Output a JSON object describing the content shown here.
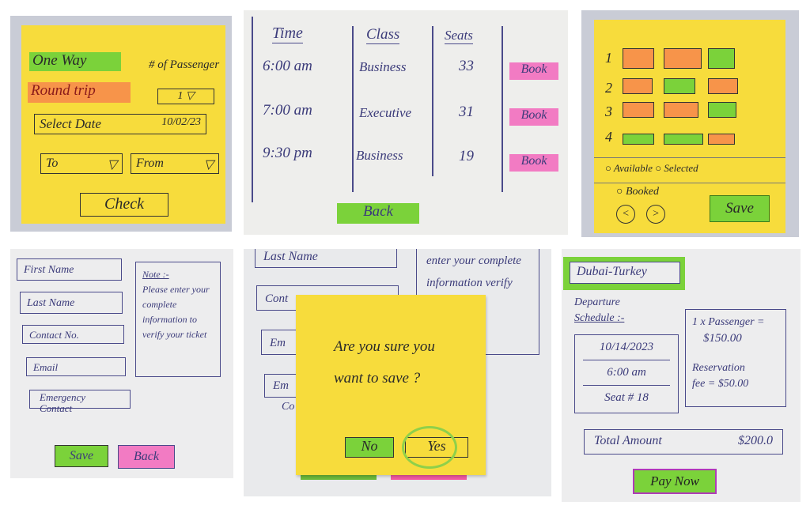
{
  "search_screen": {
    "one_way": "One Way",
    "round_trip": "Round trip",
    "passengers_label": "# of Passenger",
    "passengers_value": "1",
    "select_date_label": "Select Date",
    "select_date_value": "10/02/23",
    "to_label": "To",
    "from_label": "From",
    "check_button": "Check"
  },
  "flights_screen": {
    "headers": [
      "Time",
      "Class",
      "Seats"
    ],
    "rows": [
      {
        "time": "6:00 am",
        "class": "Business",
        "seats": "33",
        "action": "Book"
      },
      {
        "time": "7:00 am",
        "class": "Executive",
        "seats": "31",
        "action": "Book"
      },
      {
        "time": "9:30 pm",
        "class": "Business",
        "seats": "19",
        "action": "Book"
      }
    ],
    "back_button": "Back"
  },
  "seat_screen": {
    "row_labels": [
      "1",
      "2",
      "3",
      "4"
    ],
    "seat_status": [
      [
        "booked",
        "booked",
        "available"
      ],
      [
        "booked",
        "available",
        "booked"
      ],
      [
        "booked",
        "booked",
        "available"
      ],
      [
        "available",
        "available",
        "booked"
      ]
    ],
    "colors": {
      "available": "#7bd23a",
      "booked": "#f7944a"
    },
    "legend_available": "Available",
    "legend_selected": "Selected",
    "legend_booked": "Booked",
    "prev_icon": "chevron-left-icon",
    "next_icon": "chevron-right-icon",
    "save_button": "Save"
  },
  "passenger_form": {
    "first_name": "First Name",
    "last_name": "Last Name",
    "contact": "Contact No.",
    "email": "Email",
    "emergency": "Emergency Contact",
    "note_title": "Note :-",
    "note_text": "Please enter your complete information to verify your ticket",
    "save_button": "Save",
    "back_button": "Back"
  },
  "confirm_dialog": {
    "bg_last_name": "Last Name",
    "bg_contact": "Cont",
    "bg_email": "Em",
    "bg_emergency": "Em",
    "bg_emergency_sub": "Co",
    "bg_note": "enter your complete information verify ticket",
    "message": "Are you sure you want to save ?",
    "no_button": "No",
    "yes_button": "Yes"
  },
  "payment_screen": {
    "route": "Dubai-Turkey",
    "departure_label": "Departure",
    "schedule_label": "Schedule :-",
    "date": "10/14/2023",
    "time": "6:00 am",
    "seat": "Seat # 18",
    "passenger_line": "1 x Passenger =",
    "passenger_price": "$150.00",
    "reservation_line": "Reservation",
    "reservation_fee": "fee = $50.00",
    "total_label": "Total Amount",
    "total_value": "$200.0",
    "pay_button": "Pay Now"
  }
}
